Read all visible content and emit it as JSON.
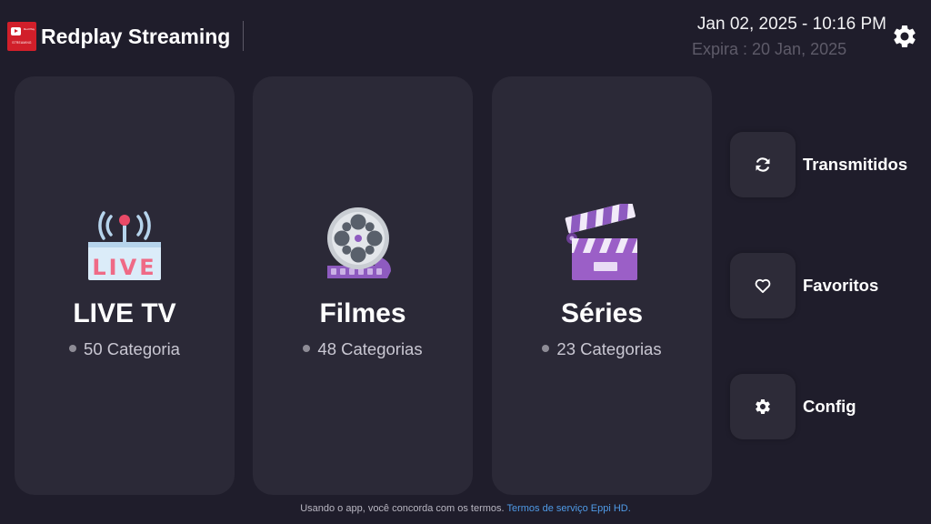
{
  "header": {
    "logo_line1": "Red Play",
    "logo_line2": "STREAMING",
    "app_title": "Redplay Streaming",
    "datetime": "Jan 02, 2025 - 10:16 PM",
    "expiry": "Expira : 20 Jan, 2025",
    "settings_icon": "gear-icon"
  },
  "cards": [
    {
      "title": "LIVE TV",
      "subtitle": "50 Categoria",
      "icon": "live-tv-antenna-icon"
    },
    {
      "title": "Filmes",
      "subtitle": "48 Categorias",
      "icon": "film-reel-icon"
    },
    {
      "title": "Séries",
      "subtitle": "23 Categorias",
      "icon": "clapperboard-icon"
    }
  ],
  "side_menu": [
    {
      "label": "Transmitidos",
      "icon": "refresh-icon"
    },
    {
      "label": "Favoritos",
      "icon": "heart-icon"
    },
    {
      "label": "Config",
      "icon": "gear-icon"
    }
  ],
  "footer": {
    "text": "Usando o app, você concorda com os termos.",
    "link": "Termos de serviço Eppi HD."
  },
  "colors": {
    "background": "#1f1d2b",
    "card": "#2b2937",
    "brand_red": "#d11f2a",
    "link": "#4f9ae6",
    "accent_purple": "#9b5fc7"
  }
}
